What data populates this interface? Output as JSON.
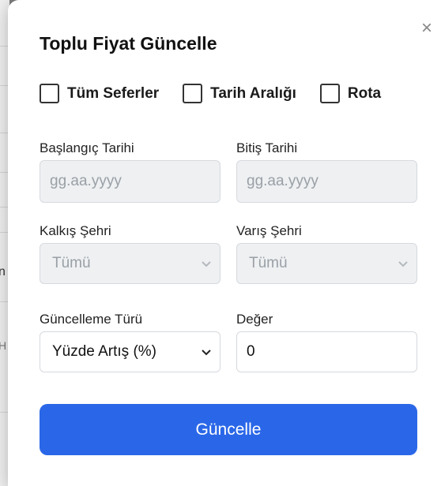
{
  "background": {
    "fragment_1": "n",
    "fragment_2": "H"
  },
  "modal": {
    "title": "Toplu Fiyat Güncelle",
    "close_glyph": "×",
    "checkboxes": [
      {
        "label": "Tüm Seferler",
        "checked": false
      },
      {
        "label": "Tarih Aralığı",
        "checked": false
      },
      {
        "label": "Rota",
        "checked": false
      }
    ],
    "start_date": {
      "label": "Başlangıç Tarihi",
      "placeholder": "gg.aa.yyyy"
    },
    "end_date": {
      "label": "Bitiş Tarihi",
      "placeholder": "gg.aa.yyyy"
    },
    "departure_city": {
      "label": "Kalkış Şehri",
      "value": "Tümü"
    },
    "arrival_city": {
      "label": "Varış Şehri",
      "value": "Tümü"
    },
    "update_type": {
      "label": "Güncelleme Türü",
      "value": "Yüzde Artış (%)"
    },
    "amount": {
      "label": "Değer",
      "value": "0"
    },
    "submit_label": "Güncelle"
  },
  "colors": {
    "primary": "#2a67e8",
    "disabled_bg": "#eef0f2",
    "border": "#d6d9de"
  }
}
